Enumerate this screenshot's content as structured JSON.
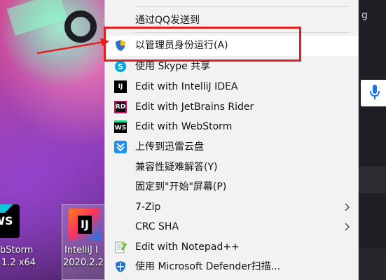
{
  "desktop": {
    "right_text": "g",
    "icons": [
      {
        "name": "webstorm",
        "tile": "WS",
        "line1": "bStorm",
        "line2": "1.2 x64"
      },
      {
        "name": "intellij",
        "tile": "IJ",
        "line1": "IntelliJ I",
        "line2": "2020.2.2"
      }
    ]
  },
  "menu": {
    "items": [
      {
        "label": "通过QQ发送到",
        "icon": "none"
      },
      {
        "label": "以管理员身份运行(A)",
        "icon": "shield-icon",
        "highlighted": true
      },
      {
        "label": "使用 Skype 共享",
        "icon": "skype-icon"
      },
      {
        "label": "Edit with IntelliJ IDEA",
        "icon": "intellij-icon",
        "badge": "IJ"
      },
      {
        "label": "Edit with JetBrains Rider",
        "icon": "rider-icon",
        "badge": "RD"
      },
      {
        "label": "Edit with WebStorm",
        "icon": "webstorm-icon",
        "badge": "WS"
      },
      {
        "label": "上传到迅雷云盘",
        "icon": "thunder-cloud-icon"
      },
      {
        "label": "兼容性疑难解答(Y)",
        "icon": "none"
      },
      {
        "label": "固定到\"开始\"屏幕(P)",
        "icon": "none"
      },
      {
        "label": "7-Zip",
        "icon": "none",
        "submenu": true
      },
      {
        "label": "CRC SHA",
        "icon": "none",
        "submenu": true
      },
      {
        "label": "Edit with Notepad++",
        "icon": "notepadpp-icon"
      },
      {
        "label": "使用 Microsoft Defender扫描...",
        "icon": "defender-icon"
      }
    ]
  },
  "colors": {
    "menu_bg": "#f2f2f2",
    "annotation_red": "#e02020"
  }
}
